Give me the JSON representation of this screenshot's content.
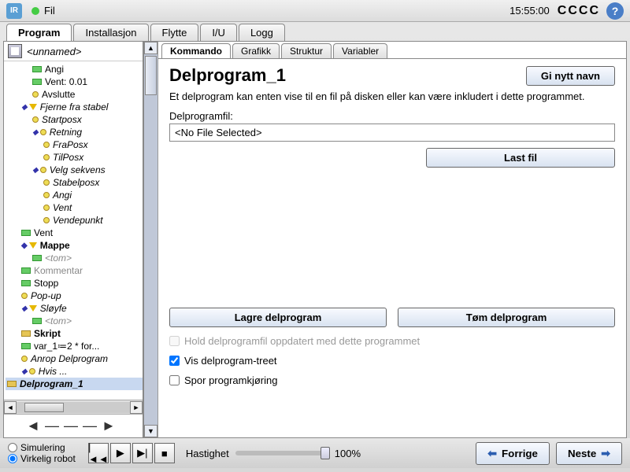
{
  "topbar": {
    "file_menu": "Fil",
    "clock": "15:55:00",
    "cccc": "CCCC"
  },
  "main_tabs": [
    "Program",
    "Installasjon",
    "Flytte",
    "I/U",
    "Logg"
  ],
  "main_tab_active": 0,
  "program_name": "<unnamed>",
  "tree": [
    {
      "ind": 2,
      "icon": "grn",
      "label": "Angi"
    },
    {
      "ind": 2,
      "icon": "grn",
      "label": "Vent: 0.01"
    },
    {
      "ind": 2,
      "icon": "yel",
      "label": "Avslutte"
    },
    {
      "ind": 1,
      "exp": true,
      "icon": "tri",
      "label": "Fjerne fra stabel",
      "italic": true
    },
    {
      "ind": 2,
      "icon": "yel",
      "label": "Startposx",
      "italic": true
    },
    {
      "ind": 2,
      "exp": true,
      "icon": "yel",
      "label": "Retning",
      "italic": true
    },
    {
      "ind": 3,
      "icon": "yel",
      "label": "FraPosx",
      "italic": true
    },
    {
      "ind": 3,
      "icon": "yel",
      "label": "TilPosx",
      "italic": true
    },
    {
      "ind": 2,
      "exp": true,
      "icon": "yel",
      "label": "Velg sekvens",
      "italic": true
    },
    {
      "ind": 3,
      "icon": "yel",
      "label": "Stabelposx",
      "italic": true
    },
    {
      "ind": 3,
      "icon": "yel",
      "label": "Angi",
      "italic": true
    },
    {
      "ind": 3,
      "icon": "yel",
      "label": "Vent",
      "italic": true
    },
    {
      "ind": 3,
      "icon": "yel",
      "label": "Vendepunkt",
      "italic": true
    },
    {
      "ind": 1,
      "icon": "grn",
      "label": "Vent"
    },
    {
      "ind": 1,
      "exp": true,
      "icon": "tri",
      "label": "Mappe",
      "bold": true
    },
    {
      "ind": 2,
      "icon": "grn",
      "label": "<tom>",
      "italic": true,
      "gray": true
    },
    {
      "ind": 1,
      "icon": "grn",
      "label": "Kommentar",
      "gray": true
    },
    {
      "ind": 1,
      "icon": "grn",
      "label": "Stopp"
    },
    {
      "ind": 1,
      "icon": "yel",
      "label": "Pop-up",
      "italic": true
    },
    {
      "ind": 1,
      "exp": true,
      "icon": "tri",
      "label": "Sløyfe",
      "italic": true
    },
    {
      "ind": 2,
      "icon": "grn",
      "label": "<tom>",
      "italic": true,
      "gray": true
    },
    {
      "ind": 1,
      "icon": "scr",
      "label": "Skript",
      "bold": true
    },
    {
      "ind": 1,
      "icon": "grn",
      "label": "var_1≔2 * for..."
    },
    {
      "ind": 1,
      "icon": "yel",
      "label": "Anrop Delprogram",
      "italic": true
    },
    {
      "ind": 1,
      "exp": true,
      "icon": "yel",
      "label": "Hvis ...",
      "italic": true
    },
    {
      "ind": 0,
      "icon": "scr",
      "label": "Delprogram_1",
      "bold": true,
      "italic": true,
      "selected": true
    }
  ],
  "nav_arrows": "◄―――►",
  "sub_tabs": [
    "Kommando",
    "Grafikk",
    "Struktur",
    "Variabler"
  ],
  "sub_tab_active": 0,
  "detail": {
    "title": "Delprogram_1",
    "rename": "Gi nytt navn",
    "desc": "Et delprogram kan enten vise til en fil på disken eller kan være inkludert i dette programmet.",
    "file_label": "Delprogramfil:",
    "file_value": "<No File Selected>",
    "load": "Last fil",
    "save_sub": "Lagre delprogram",
    "clear_sub": "Tøm delprogram",
    "chk_keep": "Hold delprogramfil oppdatert med dette programmet",
    "chk_show": "Vis delprogram-treet",
    "chk_trace": "Spor programkjøring",
    "chk_show_checked": true
  },
  "bottom": {
    "sim": "Simulering",
    "real": "Virkelig robot",
    "speed_label": "Hastighet",
    "speed_value": "100%",
    "prev": "Forrige",
    "next": "Neste"
  }
}
